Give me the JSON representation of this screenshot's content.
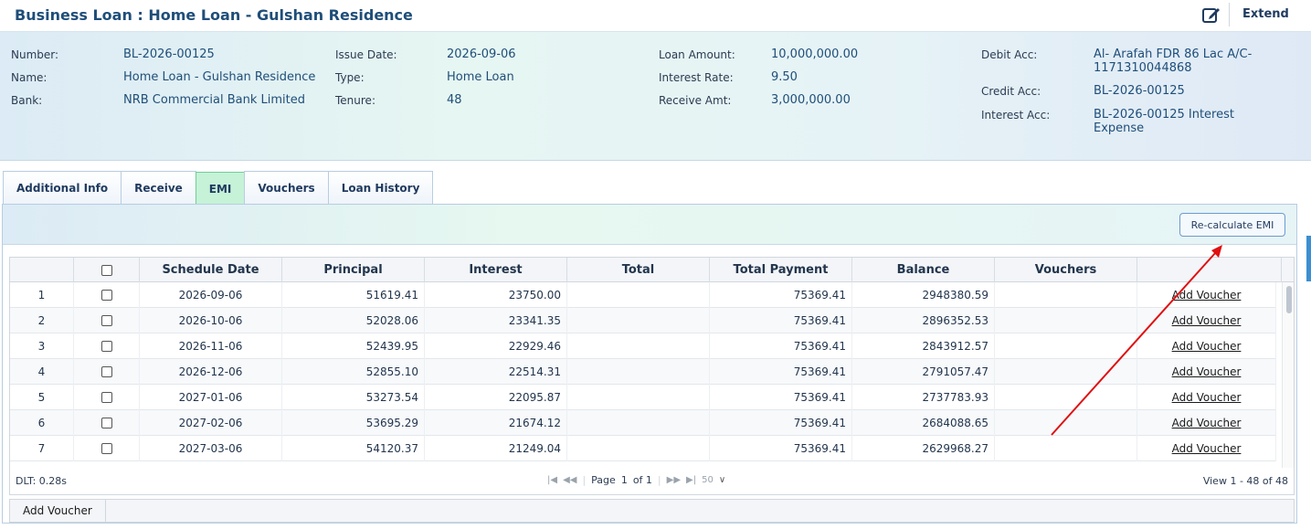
{
  "header": {
    "title": "Business Loan : Home Loan - Gulshan Residence",
    "extend_label": "Extend"
  },
  "info": {
    "number_label": "Number",
    "number": "BL-2026-00125",
    "name_label": "Name",
    "name": "Home Loan - Gulshan Residence",
    "bank_label": "Bank",
    "bank": "NRB Commercial Bank Limited",
    "issue_date_label": "Issue Date",
    "issue_date": "2026-09-06",
    "type_label": "Type",
    "type": "Home Loan",
    "tenure_label": "Tenure",
    "tenure": "48",
    "loan_amount_label": "Loan Amount",
    "loan_amount": "10,000,000.00",
    "interest_rate_label": "Interest Rate",
    "interest_rate": "9.50",
    "receive_amt_label": "Receive Amt",
    "receive_amt": "3,000,000.00",
    "debit_acc_label": "Debit Acc",
    "debit_acc": "Al- Arafah FDR 86 Lac A/C-1171310044868",
    "credit_acc_label": "Credit Acc",
    "credit_acc": "BL-2026-00125",
    "interest_acc_label": "Interest Acc",
    "interest_acc": "BL-2026-00125 Interest Expense"
  },
  "tabs": [
    {
      "label": "Additional Info"
    },
    {
      "label": "Receive"
    },
    {
      "label": "EMI"
    },
    {
      "label": "Vouchers"
    },
    {
      "label": "Loan History"
    }
  ],
  "toolbar": {
    "recalc_label": "Re-calculate EMI"
  },
  "grid": {
    "columns": [
      "Schedule Date",
      "Principal",
      "Interest",
      "Total",
      "Total Payment",
      "Balance",
      "Vouchers"
    ],
    "rows": [
      {
        "n": "1",
        "date": "2026-09-06",
        "principal": "51619.41",
        "interest": "23750.00",
        "total": "",
        "payment": "75369.41",
        "balance": "2948380.59",
        "voucher": "",
        "action": "Add Voucher"
      },
      {
        "n": "2",
        "date": "2026-10-06",
        "principal": "52028.06",
        "interest": "23341.35",
        "total": "",
        "payment": "75369.41",
        "balance": "2896352.53",
        "voucher": "",
        "action": "Add Voucher"
      },
      {
        "n": "3",
        "date": "2026-11-06",
        "principal": "52439.95",
        "interest": "22929.46",
        "total": "",
        "payment": "75369.41",
        "balance": "2843912.57",
        "voucher": "",
        "action": "Add Voucher"
      },
      {
        "n": "4",
        "date": "2026-12-06",
        "principal": "52855.10",
        "interest": "22514.31",
        "total": "",
        "payment": "75369.41",
        "balance": "2791057.47",
        "voucher": "",
        "action": "Add Voucher"
      },
      {
        "n": "5",
        "date": "2027-01-06",
        "principal": "53273.54",
        "interest": "22095.87",
        "total": "",
        "payment": "75369.41",
        "balance": "2737783.93",
        "voucher": "",
        "action": "Add Voucher"
      },
      {
        "n": "6",
        "date": "2027-02-06",
        "principal": "53695.29",
        "interest": "21674.12",
        "total": "",
        "payment": "75369.41",
        "balance": "2684088.65",
        "voucher": "",
        "action": "Add Voucher"
      },
      {
        "n": "7",
        "date": "2027-03-06",
        "principal": "54120.37",
        "interest": "21249.04",
        "total": "",
        "payment": "75369.41",
        "balance": "2629968.27",
        "voucher": "",
        "action": "Add Voucher"
      }
    ]
  },
  "pager": {
    "dlt": "DLT: 0.28s",
    "page_label": "Page",
    "page_value": "1",
    "of_label": "of 1",
    "page_size": "50",
    "view_text": "View 1 - 48 of 48"
  },
  "footer": {
    "add_voucher_label": "Add Voucher"
  },
  "colors": {
    "active_tab": "#c6f2d8",
    "title": "#1f4e79",
    "annotation_arrow": "#e01010"
  }
}
